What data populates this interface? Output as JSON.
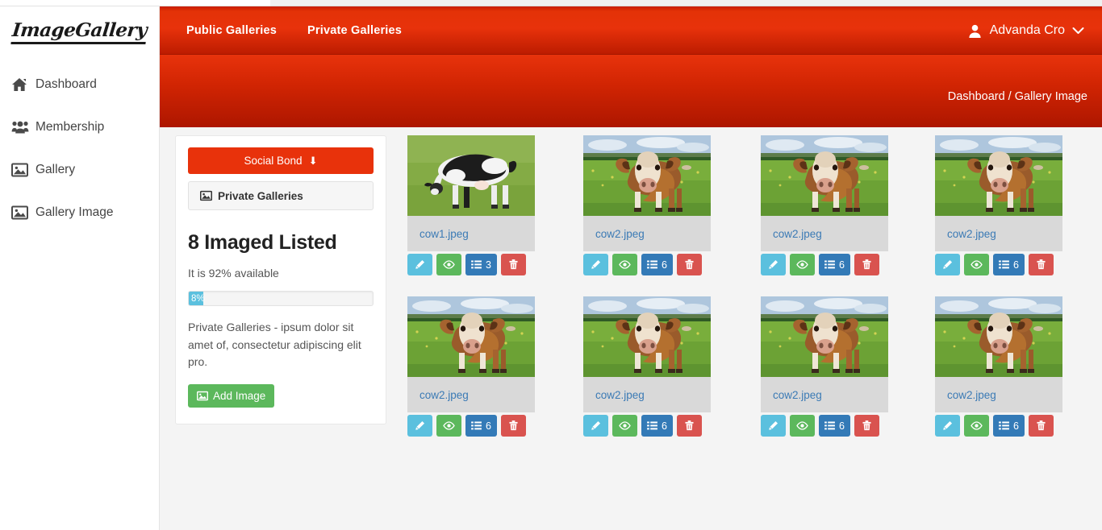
{
  "brand": {
    "logo_text": "ImageGallery"
  },
  "sidebar": {
    "items": [
      {
        "label": "Dashboard",
        "icon": "home-icon"
      },
      {
        "label": "Membership",
        "icon": "users-icon"
      },
      {
        "label": "Gallery",
        "icon": "picture-icon"
      },
      {
        "label": "Gallery Image",
        "icon": "picture-icon"
      }
    ]
  },
  "topbar": {
    "links": [
      {
        "label": "Public Galleries"
      },
      {
        "label": "Private Galleries"
      }
    ],
    "user": {
      "name": "Advanda Cro",
      "avatar_icon": "user-icon",
      "caret_icon": "chevron-down-icon"
    }
  },
  "subbar": {
    "breadcrumb": "Dashboard / Gallery Image"
  },
  "info_card": {
    "social_bond_label": "Social Bond",
    "social_bond_icon": "arrow-down-icon",
    "list_item_label": "Private Galleries",
    "list_item_icon": "picture-icon",
    "title": "8 Imaged Listed",
    "availability_text": "It is 92% available",
    "progress": {
      "label": "8%",
      "percent": 8,
      "color": "#5bc0de"
    },
    "description": "Private Galleries - ipsum dolor sit amet of, consectetur adipiscing elit pro.",
    "add_image_label": "Add Image",
    "add_image_icon": "picture-icon"
  },
  "gallery": {
    "button_labels": {
      "edit": "pencil-icon",
      "view": "eye-icon",
      "list": "list-icon",
      "delete": "trash-icon"
    },
    "items": [
      {
        "filename": "cow1.jpeg",
        "count": "3",
        "image": "holstein-cow-grazing"
      },
      {
        "filename": "cow2.jpeg",
        "count": "6",
        "image": "brown-cow-facing"
      },
      {
        "filename": "cow2.jpeg",
        "count": "6",
        "image": "brown-cow-facing"
      },
      {
        "filename": "cow2.jpeg",
        "count": "6",
        "image": "brown-cow-facing"
      },
      {
        "filename": "cow2.jpeg",
        "count": "6",
        "image": "brown-cow-facing"
      },
      {
        "filename": "cow2.jpeg",
        "count": "6",
        "image": "brown-cow-facing"
      },
      {
        "filename": "cow2.jpeg",
        "count": "6",
        "image": "brown-cow-facing"
      },
      {
        "filename": "cow2.jpeg",
        "count": "6",
        "image": "brown-cow-facing"
      }
    ]
  },
  "colors": {
    "brand_red": "#e8320b",
    "dark_red": "#ad1600",
    "accent_blue": "#337ab7",
    "accent_green": "#5cb85c",
    "accent_cyan": "#5bc0de",
    "accent_danger": "#d9534f",
    "caption_bg": "#d9d9d9",
    "content_bg": "#f4f4f4"
  }
}
